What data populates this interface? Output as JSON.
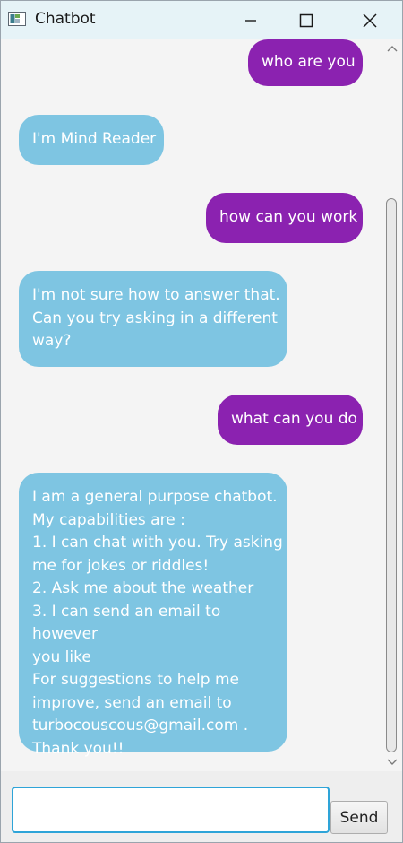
{
  "window": {
    "title": "Chatbot"
  },
  "messages": [
    {
      "sender": "user",
      "text": "who are you"
    },
    {
      "sender": "bot",
      "text": "I'm Mind Reader"
    },
    {
      "sender": "user",
      "text": "how can you work"
    },
    {
      "sender": "bot",
      "text": "I'm not sure how to answer that.\nCan you try asking in a different\nway?"
    },
    {
      "sender": "user",
      "text": "what can you do"
    },
    {
      "sender": "bot",
      "text": "I am a general purpose chatbot.\nMy capabilities are :\n 1. I can chat with you. Try asking\nme for jokes or riddles!\n 2. Ask me about the weather\n 3. I can send an email to however\nyou like\n For suggestions to help me\nimprove, send an email to\nturbocouscous@gmail.com .\nThank you!!"
    }
  ],
  "input": {
    "value": "",
    "send_label": "Send"
  },
  "colors": {
    "user_bubble": "#8b22b0",
    "bot_bubble": "#7ec5e2",
    "titlebar": "#e6f3f7",
    "input_focus": "#2ea4d8"
  }
}
